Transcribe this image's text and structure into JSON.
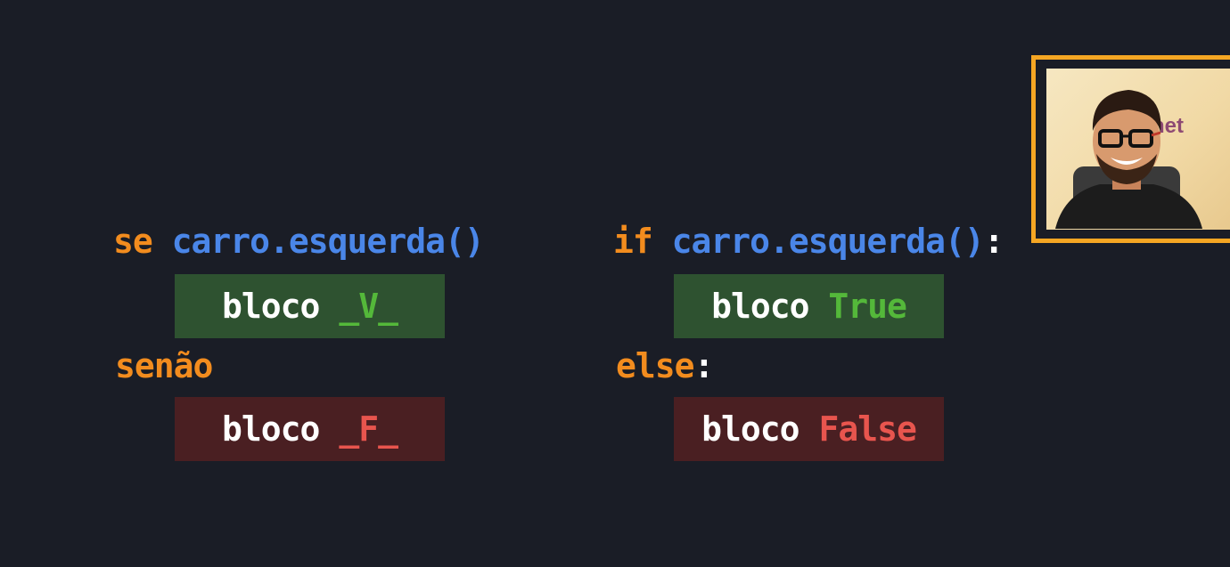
{
  "left": {
    "if_keyword": "se",
    "condition": "carro.esquerda()",
    "true_block_word": "bloco",
    "true_block_value": "_V_",
    "else_keyword": "senão",
    "false_block_word": "bloco",
    "false_block_value": "_F_"
  },
  "right": {
    "if_keyword": "if",
    "condition": "carro.esquerda()",
    "colon": ":",
    "true_block_word": "bloco",
    "true_block_value": "True",
    "else_keyword": "else",
    "else_colon": ":",
    "false_block_word": "bloco",
    "false_block_value": "False"
  },
  "colors": {
    "keyword": "#f28c1e",
    "function": "#4a86e8",
    "true_bg": "#2e5230",
    "false_bg": "#4a1f22",
    "true_text": "#54b83a",
    "false_text": "#e8554e",
    "frame": "#f5a623"
  },
  "webcam": {
    "logo_text": "net"
  }
}
